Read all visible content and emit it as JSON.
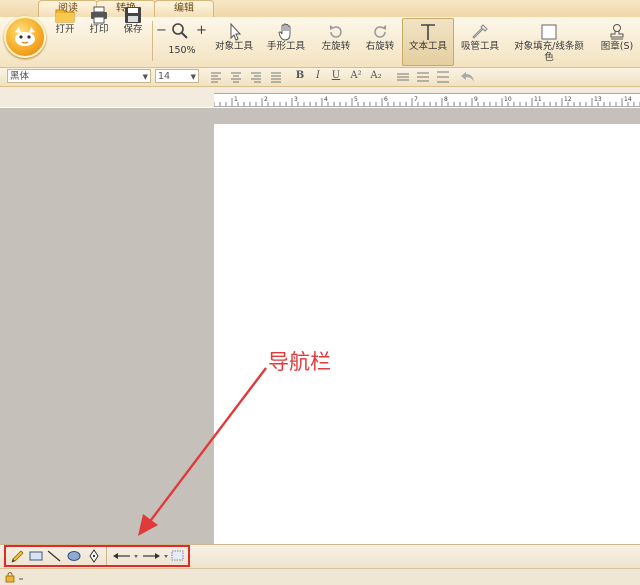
{
  "tabs": [
    {
      "label": "阅读"
    },
    {
      "label": "转换"
    },
    {
      "label": "编辑"
    }
  ],
  "toolbar": {
    "open": "打开",
    "print": "打印",
    "save": "保存",
    "zoom_minus": "−",
    "zoom_plus": "+",
    "zoom_value": "150%",
    "object_tool": "对象工具",
    "hand_tool": "手形工具",
    "rotate_left": "左旋转",
    "rotate_right": "右旋转",
    "text_tool": "文本工具",
    "eyedropper_tool": "吸管工具",
    "fill_tool_line1": "对象填充/线条颜",
    "fill_tool_line2": "色",
    "stamp": "图章(S)"
  },
  "format": {
    "font": "黑体",
    "size": "14",
    "bold": "B",
    "italic": "I",
    "underline": "U",
    "superscript": "A²",
    "subscript": "A₂"
  },
  "ruler": {
    "labels": [
      "1",
      "2",
      "3",
      "4",
      "5",
      "6",
      "7",
      "8",
      "9",
      "10",
      "11",
      "12",
      "13",
      "14"
    ]
  },
  "annotation": {
    "text": "导航栏"
  },
  "colors": {
    "annotation": "#e03a3a",
    "accent": "#f5a623"
  }
}
